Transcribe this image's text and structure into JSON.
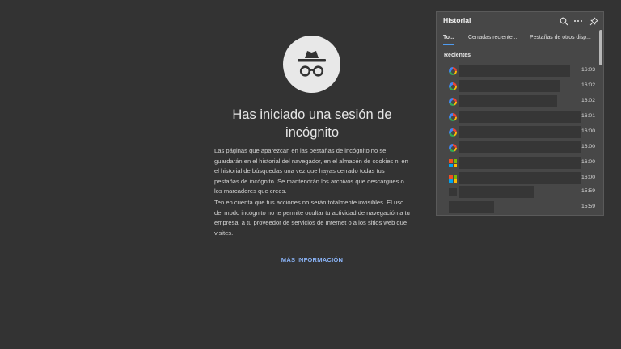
{
  "incognito": {
    "title": "Has iniciado una sesión de incógnito",
    "paragraph1": "Las páginas que aparezcan en las pestañas de incógnito no se guardarán en el historial del navegador, en el almacén de cookies ni en el historial de búsquedas una vez que hayas cerrado todas tus pestañas de incógnito. Se mantendrán los archivos que descargues o los marcadores que crees.",
    "paragraph2": "Ten en cuenta que tus acciones no serán totalmente invisibles. El uso del modo incógnito no te permite ocultar tu actividad de navegación a tu empresa, a tu proveedor de servicios de Internet o a los sitios web que visites.",
    "more_info": "MÁS INFORMACIÓN",
    "icon": "incognito-icon"
  },
  "history": {
    "title": "Historial",
    "tabs": [
      {
        "label": "To..."
      },
      {
        "label": "Cerradas reciente..."
      },
      {
        "label": "Pestañas de otros disp..."
      }
    ],
    "section": "Recientes",
    "items": [
      {
        "favicon": "google",
        "time": "16:03"
      },
      {
        "favicon": "google",
        "time": "16:02"
      },
      {
        "favicon": "google",
        "time": "16:02"
      },
      {
        "favicon": "google",
        "time": "16:01"
      },
      {
        "favicon": "google",
        "time": "16:00"
      },
      {
        "favicon": "google",
        "time": "16:00"
      },
      {
        "favicon": "microsoft",
        "time": "16:00"
      },
      {
        "favicon": "microsoft",
        "time": "16:00"
      },
      {
        "favicon": "blank",
        "time": "15:59"
      },
      {
        "favicon": "none",
        "time": "15:59"
      }
    ],
    "icons": {
      "search": "search-icon",
      "more": "more-icon",
      "pin": "pin-icon"
    }
  }
}
